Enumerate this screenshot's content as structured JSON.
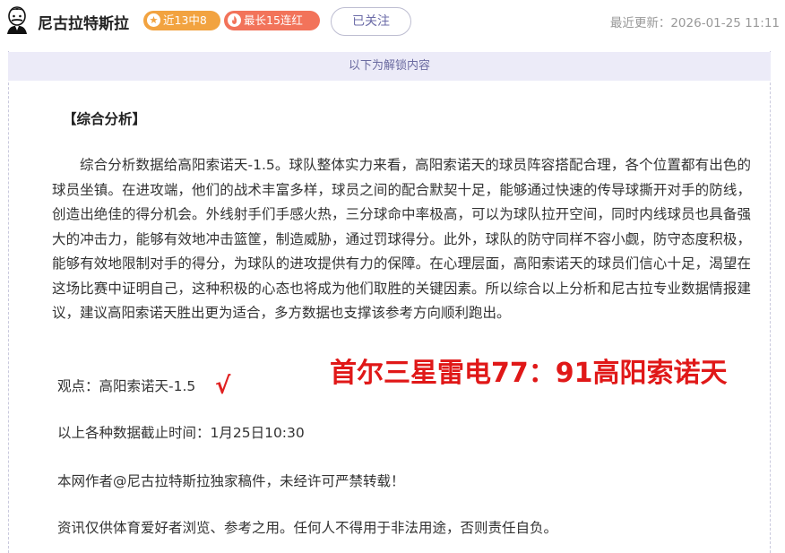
{
  "header": {
    "author_name": "尼古拉特斯拉",
    "badge_recent": "近13中8",
    "badge_streak": "最长15连红",
    "follow_label": "已关注",
    "updated": "最近更新：2026-01-25 11:11"
  },
  "unlock_bar": "以下为解锁内容",
  "article": {
    "section_title": "【综合分析】",
    "analysis": "综合分析数据给高阳索诺天-1.5。球队整体实力来看，高阳索诺天的球员阵容搭配合理，各个位置都有出色的球员坐镇。在进攻端，他们的战术丰富多样，球员之间的配合默契十足，能够通过快速的传导球撕开对手的防线，创造出绝佳的得分机会。外线射手们手感火热，三分球命中率极高，可以为球队拉开空间，同时内线球员也具备强大的冲击力，能够有效地冲击篮筐，制造威胁，通过罚球得分。此外，球队的防守同样不容小觑，防守态度积极，能够有效地限制对手的得分，为球队的进攻提供有力的保障。在心理层面，高阳索诺天的球员们信心十足，渴望在这场比赛中证明自己，这种积极的心态也将成为他们取胜的关键因素。所以综合以上分析和尼古拉专业数据情报建议，建议高阳索诺天胜出更为适合，多方数据也支撑该参考方向顺利跑出。",
    "viewpoint": "观点：高阳索诺天-1.5",
    "check_mark": "√",
    "score_result": "首尔三星雷电77：91高阳索诺天",
    "deadline": "以上各种数据截止时间：1月25日10:30",
    "copyright": "本网作者@尼古拉特斯拉独家稿件，未经许可严禁转载！",
    "disclaimer": "资讯仅供体育爱好者浏览、参考之用。任何人不得用于非法用途，否则责任自负。"
  },
  "colors": {
    "badge_recent": "#f2a340",
    "badge_streak": "#f2735a",
    "unlock_bar_bg": "#ecebf8",
    "score_red": "#e01818"
  },
  "icons": {
    "avatar": "tesla-portrait-avatar",
    "badge_recent_icon": "star-icon",
    "badge_streak_icon": "flame-icon"
  }
}
